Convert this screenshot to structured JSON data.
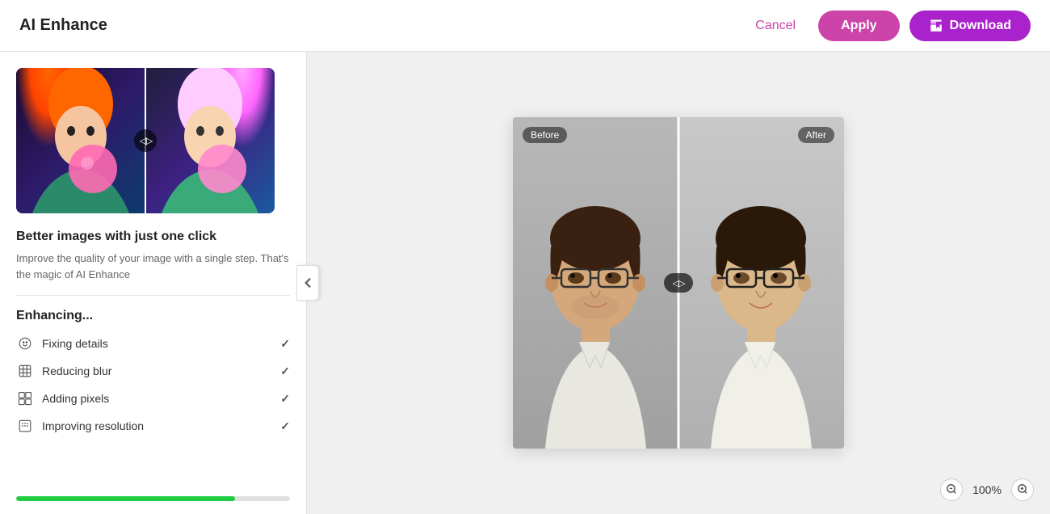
{
  "header": {
    "title": "AI Enhance",
    "cancel_label": "Cancel",
    "apply_label": "Apply",
    "download_label": "Download"
  },
  "left_panel": {
    "heading": "Better images with just one click",
    "description": "Improve the quality of your image with a single step. That's the magic of AI Enhance",
    "enhancing_title": "Enhancing...",
    "steps": [
      {
        "id": "fixing-details",
        "label": "Fixing details",
        "checked": true
      },
      {
        "id": "reducing-blur",
        "label": "Reducing blur",
        "checked": true
      },
      {
        "id": "adding-pixels",
        "label": "Adding pixels",
        "checked": true
      },
      {
        "id": "improving-resolution",
        "label": "Improving resolution",
        "checked": true
      }
    ],
    "progress_percent": 80
  },
  "comparison": {
    "before_label": "Before",
    "after_label": "After"
  },
  "zoom": {
    "level": "100%",
    "zoom_in_label": "+",
    "zoom_out_label": "−"
  }
}
